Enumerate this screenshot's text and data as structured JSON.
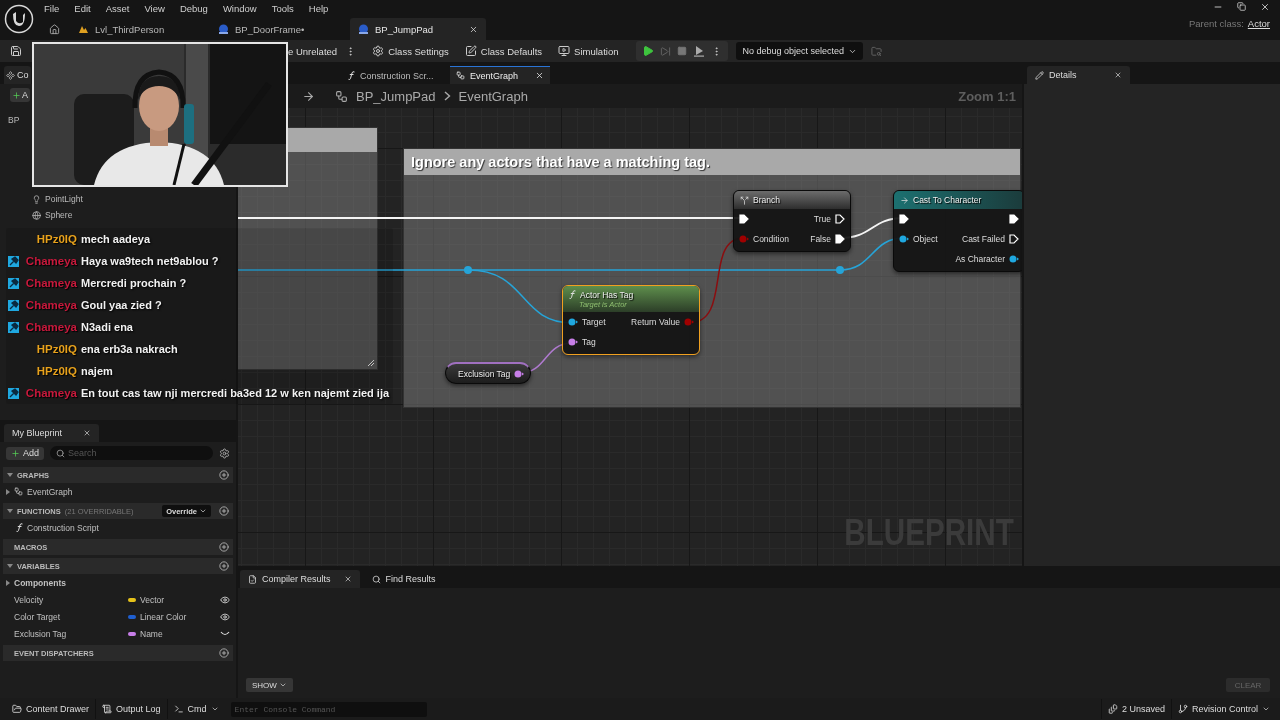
{
  "menu": [
    "File",
    "Edit",
    "Asset",
    "View",
    "Debug",
    "Window",
    "Tools",
    "Help"
  ],
  "document_tabs": [
    {
      "label": "Lvl_ThirdPerson",
      "kind": "level",
      "selected": false
    },
    {
      "label": "BP_DoorFrame•",
      "kind": "blueprint",
      "selected": false
    },
    {
      "label": "BP_JumpPad",
      "kind": "blueprint",
      "selected": true
    }
  ],
  "parent_class": {
    "label": "Parent class:",
    "value": "Actor"
  },
  "toolbar": {
    "hide_unrelated": "e Unrelated",
    "buttons": [
      {
        "label": "Class Settings",
        "kind": "settings"
      },
      {
        "label": "Class Defaults",
        "kind": "defaults"
      },
      {
        "label": "Simulation",
        "kind": "simulation"
      }
    ],
    "debug_object": "No debug object selected"
  },
  "components": {
    "tab": "Co",
    "add": "A",
    "tree": [
      {
        "label": "BP",
        "children": [
          {
            "label": "PointLight",
            "kind": "light"
          },
          {
            "label": "Sphere",
            "kind": "mesh"
          }
        ]
      }
    ]
  },
  "chat": [
    {
      "user": "HPz0IQ",
      "message": "mech aadeya",
      "color": "#e8a21c",
      "badge": false
    },
    {
      "user": "Chameya",
      "message": "Haya wa9tech net9ablou ?",
      "color": "#c8193c",
      "badge": true
    },
    {
      "user": "Chameya",
      "message": "Mercredi prochain ?",
      "color": "#c8193c",
      "badge": true
    },
    {
      "user": "Chameya",
      "message": "Goul yaa zied ?",
      "color": "#c8193c",
      "badge": true
    },
    {
      "user": "Chameya",
      "message": "N3adi ena",
      "color": "#c8193c",
      "badge": true
    },
    {
      "user": "HPz0IQ",
      "message": "ena erb3a nakrach",
      "color": "#e8a21c",
      "badge": false
    },
    {
      "user": "HPz0IQ",
      "message": "najem",
      "color": "#e8a21c",
      "badge": false
    },
    {
      "user": "Chameya",
      "message": "En tout cas taw nji mercredi ba3ed 12 w ken najemt zied ija",
      "color": "#c8193c",
      "badge": true
    }
  ],
  "graph_tabs": [
    {
      "label": "Construction Scr...",
      "kind": "function",
      "selected": false
    },
    {
      "label": "EventGraph",
      "kind": "graph",
      "selected": true
    }
  ],
  "breadcrumb": [
    "BP_JumpPad",
    "EventGraph"
  ],
  "zoom": "Zoom 1:1",
  "comment": "Ignore any actors that have a matching tag.",
  "nodes": [
    {
      "kind": "branch",
      "title": "Branch",
      "selected": false,
      "rows": [
        {
          "left": {
            "kind": "exec",
            "connected": true
          },
          "right": {
            "kind": "exec",
            "label": "True",
            "connected": false
          }
        },
        {
          "left": {
            "kind": "data",
            "label": "Condition",
            "color": "#a00000"
          },
          "right": {
            "kind": "exec",
            "label": "False",
            "connected": true
          }
        }
      ]
    },
    {
      "kind": "cast",
      "title": "Cast To Character",
      "selected": false,
      "rows": [
        {
          "left": {
            "kind": "exec",
            "connected": true
          },
          "right": {
            "kind": "exec",
            "connected": true
          }
        },
        {
          "left": {
            "kind": "data",
            "label": "Object",
            "color": "#1fa8e0"
          },
          "right": {
            "kind": "exec",
            "label": "Cast Failed",
            "connected": false
          }
        },
        {
          "right": {
            "kind": "data",
            "label": "As Character",
            "color": "#1fa8e0"
          }
        }
      ]
    },
    {
      "kind": "function",
      "title": "Actor Has Tag",
      "subtitle": "Target is Actor",
      "selected": true,
      "rows": [
        {
          "left": {
            "kind": "data",
            "label": "Target",
            "color": "#1fa8e0"
          },
          "right": {
            "kind": "data",
            "label": "Return Value",
            "color": "#a00000"
          }
        },
        {
          "left": {
            "kind": "data",
            "label": "Tag",
            "color": "#c77ee8"
          }
        }
      ]
    },
    {
      "kind": "variable",
      "title": "Exclusion Tag",
      "selected": false,
      "rows": [
        {
          "right": {
            "kind": "data",
            "color": "#c77ee8"
          }
        }
      ]
    }
  ],
  "watermark": "BLUEPRINT",
  "details_tab": "Details",
  "my_blueprint": {
    "tab": "My Blueprint",
    "add": "Add",
    "search_placeholder": "Search",
    "sections": [
      {
        "title": "GRAPHS",
        "expanded": true,
        "items": [
          {
            "label": "EventGraph",
            "kind": "graph",
            "expanded": false
          }
        ]
      },
      {
        "title": "FUNCTIONS",
        "note": "(21 OVERRIDABLE)",
        "dropdown": "Override",
        "expanded": true,
        "items": [
          {
            "label": "Construction Script",
            "kind": "function"
          }
        ]
      },
      {
        "title": "MACROS"
      },
      {
        "title": "VARIABLES",
        "expanded": true,
        "items": [
          {
            "label": "Components",
            "kind": "category",
            "expanded": false
          },
          {
            "label": "Velocity",
            "kind": "variable",
            "type": "Vector",
            "color": "#e6c21a",
            "visible": true
          },
          {
            "label": "Color Target",
            "kind": "variable",
            "type": "Linear Color",
            "color": "#1f5fd0",
            "visible": true
          },
          {
            "label": "Exclusion Tag",
            "kind": "variable",
            "type": "Name",
            "color": "#c77ee8",
            "visible": false
          }
        ]
      },
      {
        "title": "EVENT DISPATCHERS"
      }
    ]
  },
  "bottom_panel": {
    "tabs": [
      {
        "label": "Compiler Results",
        "kind": "compiler",
        "selected": true
      },
      {
        "label": "Find Results",
        "kind": "find",
        "selected": false
      }
    ],
    "show": "SHOW",
    "clear": "CLEAR"
  },
  "status_bar": {
    "content_drawer": "Content Drawer",
    "output_log": "Output Log",
    "cmd": "Cmd",
    "console_placeholder": "Enter Console Command",
    "unsaved": "2 Unsaved",
    "revision_control": "Revision Control"
  }
}
